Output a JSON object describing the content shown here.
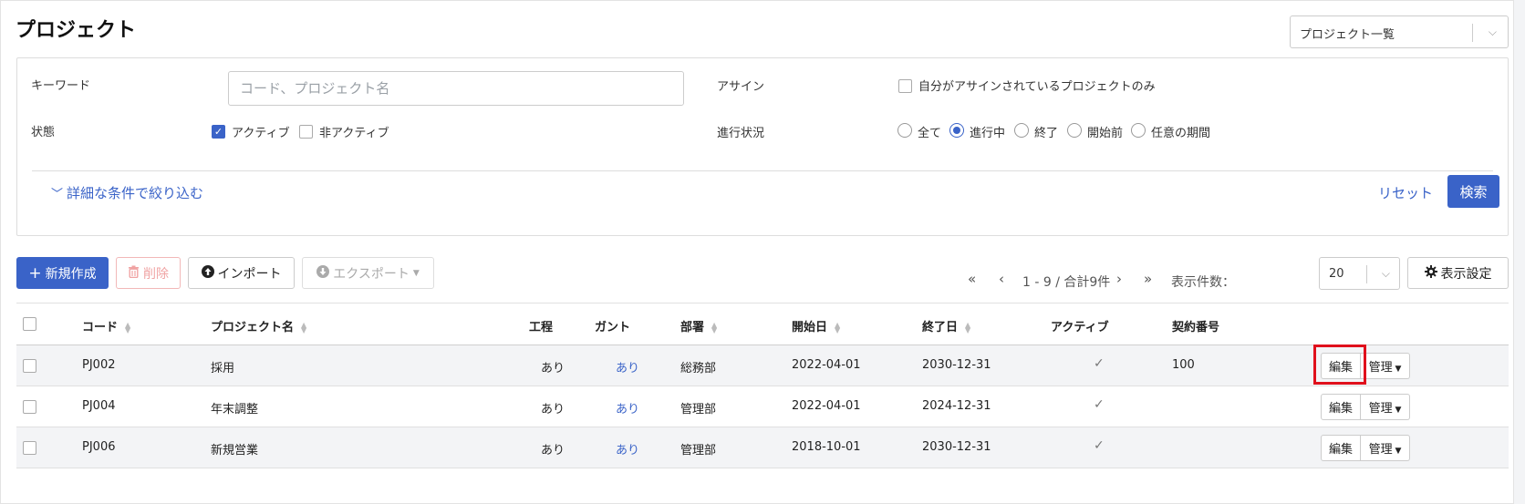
{
  "page": {
    "title": "プロジェクト"
  },
  "view_select": {
    "value": "プロジェクト一覧"
  },
  "filters": {
    "keyword": {
      "label": "キーワード",
      "placeholder": "コード、プロジェクト名",
      "value": ""
    },
    "status": {
      "label": "状態",
      "options": [
        {
          "label": "アクティブ",
          "checked": true
        },
        {
          "label": "非アクティブ",
          "checked": false
        }
      ]
    },
    "assign": {
      "label": "アサイン",
      "option": {
        "label": "自分がアサインされているプロジェクトのみ",
        "checked": false
      }
    },
    "progress": {
      "label": "進行状況",
      "options": [
        {
          "label": "全て",
          "selected": false
        },
        {
          "label": "進行中",
          "selected": true
        },
        {
          "label": "終了",
          "selected": false
        },
        {
          "label": "開始前",
          "selected": false
        },
        {
          "label": "任意の期間",
          "selected": false
        }
      ]
    },
    "advanced_label": "詳細な条件で絞り込む",
    "reset_label": "リセット",
    "search_label": "検索"
  },
  "toolbar": {
    "new_label": "新規作成",
    "delete_label": "削除",
    "import_label": "インポート",
    "export_label": "エクスポート",
    "pagination_text": "1 - 9 / 合計9件",
    "per_page_label": "表示件数：",
    "per_page_value": "20",
    "display_settings_label": "表示設定"
  },
  "table": {
    "columns": [
      "コード",
      "プロジェクト名",
      "工程",
      "ガント",
      "部署",
      "開始日",
      "終了日",
      "アクティブ",
      "契約番号"
    ],
    "rows": [
      {
        "code": "PJ002",
        "name": "採用",
        "process": "あり",
        "gantt": "あり",
        "dept": "総務部",
        "start": "2022-04-01",
        "end": "2030-12-31",
        "active": true,
        "contract": "100"
      },
      {
        "code": "PJ004",
        "name": "年末調整",
        "process": "あり",
        "gantt": "あり",
        "dept": "管理部",
        "start": "2022-04-01",
        "end": "2024-12-31",
        "active": true,
        "contract": ""
      },
      {
        "code": "PJ006",
        "name": "新規営業",
        "process": "あり",
        "gantt": "あり",
        "dept": "管理部",
        "start": "2018-10-01",
        "end": "2030-12-31",
        "active": true,
        "contract": ""
      }
    ],
    "edit_label": "編集",
    "manage_label": "管理"
  },
  "colors": {
    "accent": "#3a63c8",
    "highlight": "#e0101c",
    "row_alt": "#f3f4f6"
  },
  "icons": [
    "plus-icon",
    "trash-icon",
    "upload-circle-icon",
    "download-circle-icon",
    "gear-icon",
    "chevron-down-icon",
    "check-icon",
    "sort-icon"
  ]
}
